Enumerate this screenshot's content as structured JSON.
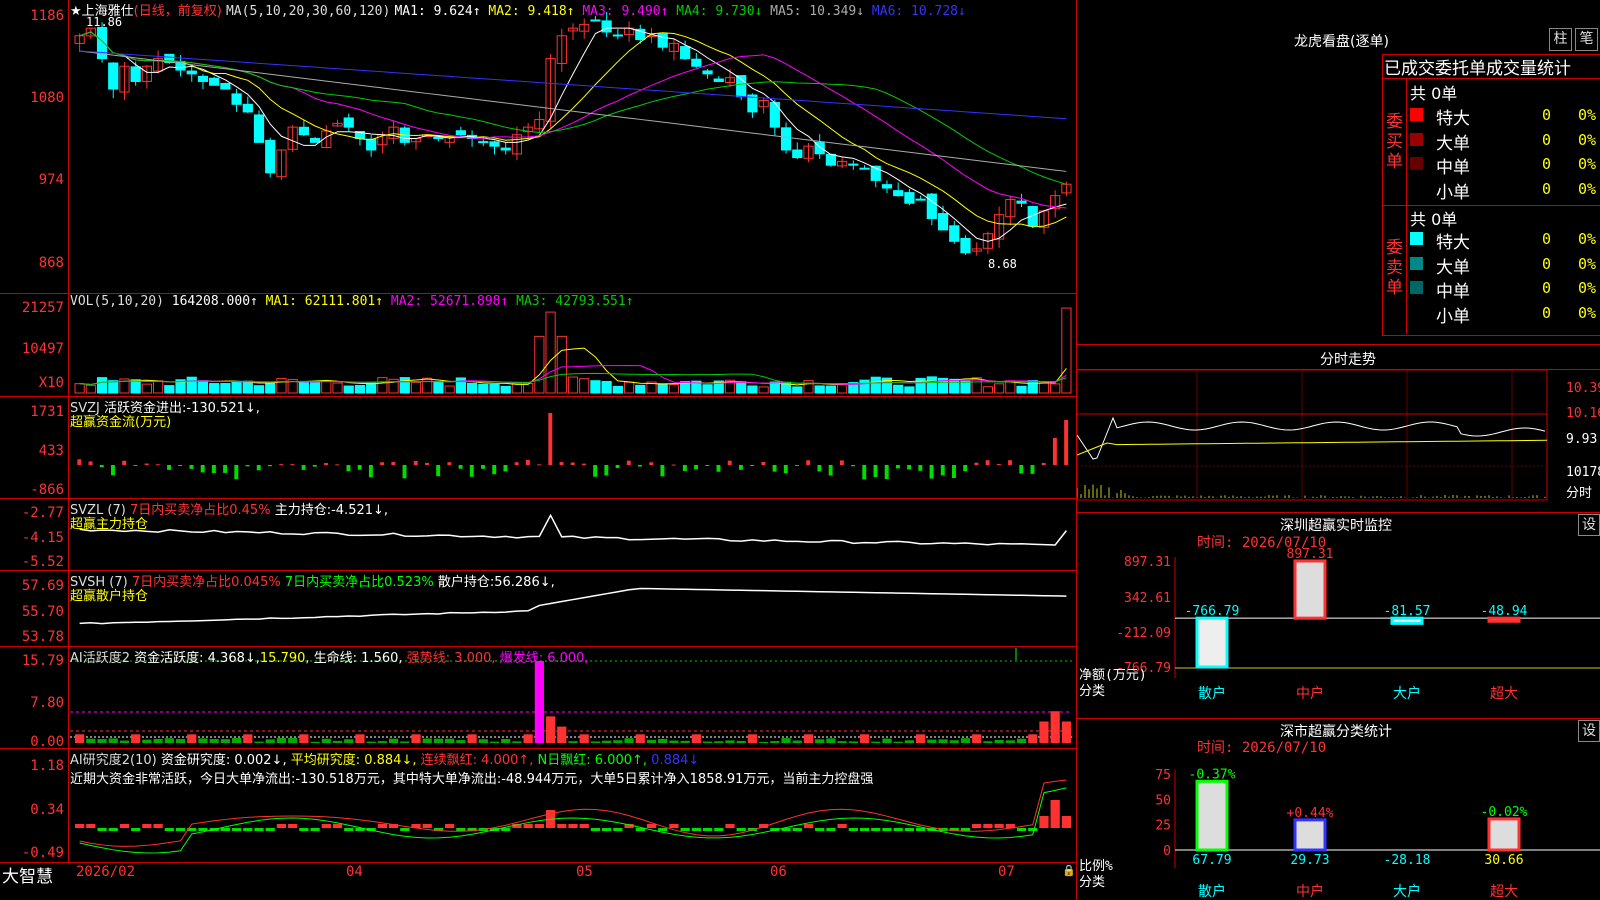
{
  "colors": {
    "up": "#ff3232",
    "down": "#00ffff",
    "vol_down": "#00ffff",
    "fund_down": "#00dd00",
    "ma1": "#ffffff",
    "ma2": "#ffff00",
    "ma3": "#ff00ff",
    "ma4": "#00cc00",
    "ma5": "#aaaaaa",
    "ma6": "#3333ff"
  },
  "kline": {
    "stock": "上海雅仕",
    "period": "(日线，前复权)",
    "star": "★",
    "ma_header": "MA(5,10,20,30,60,120)",
    "ma": [
      {
        "t": "MA1: 9.624↑",
        "c": "#ffffff"
      },
      {
        "t": "MA2: 9.418↑",
        "c": "#ffff00"
      },
      {
        "t": "MA3: 9.490↑",
        "c": "#ff00ff"
      },
      {
        "t": "MA4: 9.730↓",
        "c": "#00cc00"
      },
      {
        "t": "MA5: 10.349↓",
        "c": "#aaaaaa"
      },
      {
        "t": "MA6: 10.728↓",
        "c": "#3333ff"
      }
    ],
    "yticks": [
      "1186",
      "1080",
      "974",
      "868"
    ],
    "high_label": "11.86",
    "low_label": "8.68",
    "closes": [
      11.6,
      11.7,
      11.3,
      10.9,
      11.2,
      11.0,
      11.2,
      11.3,
      11.25,
      11.15,
      11.1,
      11.0,
      10.95,
      10.9,
      10.7,
      10.6,
      10.2,
      9.8,
      10.1,
      10.4,
      10.3,
      10.2,
      10.35,
      10.45,
      10.4,
      10.25,
      10.1,
      10.3,
      10.4,
      10.2,
      10.25,
      10.3,
      10.25,
      10.28,
      10.3,
      10.25,
      10.2,
      10.15,
      10.1,
      10.3,
      10.4,
      10.5,
      11.3,
      11.6,
      11.7,
      11.75,
      11.8,
      11.65,
      11.6,
      11.7,
      11.55,
      11.6,
      11.45,
      11.5,
      11.3,
      11.2,
      11.1,
      11.0,
      11.05,
      10.8,
      10.6,
      10.75,
      10.4,
      10.1,
      10.0,
      10.15,
      10.05,
      9.9,
      9.95,
      9.9,
      9.85,
      9.7,
      9.6,
      9.5,
      9.4,
      9.45,
      9.2,
      9.05,
      8.9,
      8.75,
      8.8,
      9.0,
      9.25,
      9.45,
      9.4,
      9.1,
      9.3,
      9.5,
      9.65
    ]
  },
  "vol": {
    "header": "VOL(5,10,20)",
    "value": "164208.000↑",
    "ma": [
      {
        "t": "MA1: 62111.801↑",
        "c": "#ffff00"
      },
      {
        "t": "MA2: 52671.898↑",
        "c": "#ff00ff"
      },
      {
        "t": "MA3: 42793.551↑",
        "c": "#00cc00"
      }
    ],
    "yticks": [
      "21257",
      "10497",
      "X10"
    ]
  },
  "svzj": {
    "header": "SVZJ",
    "label": "活跃资金进出:",
    "value": "-130.521↓,",
    "sub": "超赢资金流(万元)",
    "yticks": [
      "1731",
      "433",
      "-866"
    ]
  },
  "svzl": {
    "header": "SVZL (7)",
    "a": "7日内买卖净占比0.45%",
    "b": "主力持仓:",
    "bv": "-4.521↓,",
    "sub": "超赢主力持仓",
    "yticks": [
      "-2.77",
      "-4.15",
      "-5.52"
    ]
  },
  "svsh": {
    "header": "SVSH (7)",
    "a": "7日内买卖净占比0.045%",
    "b": "7日内买卖净占比0.523%",
    "c": "散户持仓:",
    "cv": "56.286↓,",
    "sub": "超赢散户持仓",
    "yticks": [
      "57.69",
      "55.70",
      "53.78"
    ]
  },
  "ai": {
    "header": "AI活跃度2",
    "a": "资金活跃度: 4.368↓,",
    "b": "15.790,",
    "c": "生命线: 1.560,",
    "d": "强势线: 3.000,",
    "e": "爆发线: 6.000,",
    "yticks": [
      "15.79",
      "7.80",
      "0.00"
    ]
  },
  "research": {
    "header": "AI研究度2(10)",
    "a": "资金研究度: 0.002↓,",
    "b": "平均研究度: 0.884↓,",
    "c": "连续飘红: 4.000↑,",
    "d": "N日飘红: 6.000↑,",
    "e": "0.884↓",
    "desc": "近期大资金非常活跃，今日大单净流出:-130.518万元，其中特大单净流出:-48.944万元，大单5日累计净入1858.91万元，当前主力控盘强",
    "yticks": [
      "1.18",
      "0.34",
      "-0.49"
    ]
  },
  "xaxis": {
    "brand": "大智慧",
    "dates": [
      "2026/02",
      "04",
      "05",
      "06",
      "07"
    ]
  },
  "lhb": {
    "title": "龙虎看盘(逐单)",
    "btn1": "柱",
    "btn2": "笔",
    "subtitle": "已成交委托单成交量统计",
    "buy": {
      "total": "共 0单",
      "side": "委买单",
      "rows": [
        {
          "n": "特大",
          "v": "0",
          "p": "0%",
          "c": "#ff0000"
        },
        {
          "n": "大单",
          "v": "0",
          "p": "0%",
          "c": "#990000"
        },
        {
          "n": "中单",
          "v": "0",
          "p": "0%",
          "c": "#660000"
        },
        {
          "n": "小单",
          "v": "0",
          "p": "0%",
          "c": "#000000"
        }
      ]
    },
    "sell": {
      "total": "共 0单",
      "side": "委卖单",
      "rows": [
        {
          "n": "特大",
          "v": "0",
          "p": "0%",
          "c": "#00ffff"
        },
        {
          "n": "大单",
          "v": "0",
          "p": "0%",
          "c": "#008888"
        },
        {
          "n": "中单",
          "v": "0",
          "p": "0%",
          "c": "#006666"
        },
        {
          "n": "小单",
          "v": "0",
          "p": "0%",
          "c": "#000000"
        }
      ]
    }
  },
  "intraday": {
    "title": "分时走势",
    "yticks": [
      "10.39",
      "10.16",
      "9.93",
      "10178",
      "分时"
    ]
  },
  "monitor": {
    "title": "深圳超赢实时监控",
    "btn": "设",
    "time": "时间: 2026/07/10",
    "yticks": [
      "897.31",
      "342.61",
      "-212.09",
      "-766.79"
    ],
    "axis": "净额(万元)",
    "axis2": "分类",
    "bars": [
      {
        "name": "散户",
        "value": -766.79,
        "label": "-766.79"
      },
      {
        "name": "中户",
        "value": 897.31,
        "label": "897.31"
      },
      {
        "name": "大户",
        "value": -81.57,
        "label": "-81.57"
      },
      {
        "name": "超大",
        "value": -48.94,
        "label": "-48.94"
      }
    ]
  },
  "stats": {
    "title": "深市超赢分类统计",
    "btn": "设",
    "time": "时间: 2026/07/10",
    "yticks": [
      "75",
      "50",
      "25",
      "0"
    ],
    "axis": "比例%",
    "axis2": "分类",
    "bars": [
      {
        "name": "散户",
        "value": 67.79,
        "top": "-0.37%",
        "bottom": "67.79"
      },
      {
        "name": "中户",
        "value": 29.73,
        "top": "+0.44%",
        "bottom": "29.73"
      },
      {
        "name": "大户",
        "value": 0,
        "top": "",
        "bottom": "-28.18"
      },
      {
        "name": "超大",
        "value": 30.66,
        "top": "-0.02%",
        "bottom": "30.66"
      }
    ]
  }
}
